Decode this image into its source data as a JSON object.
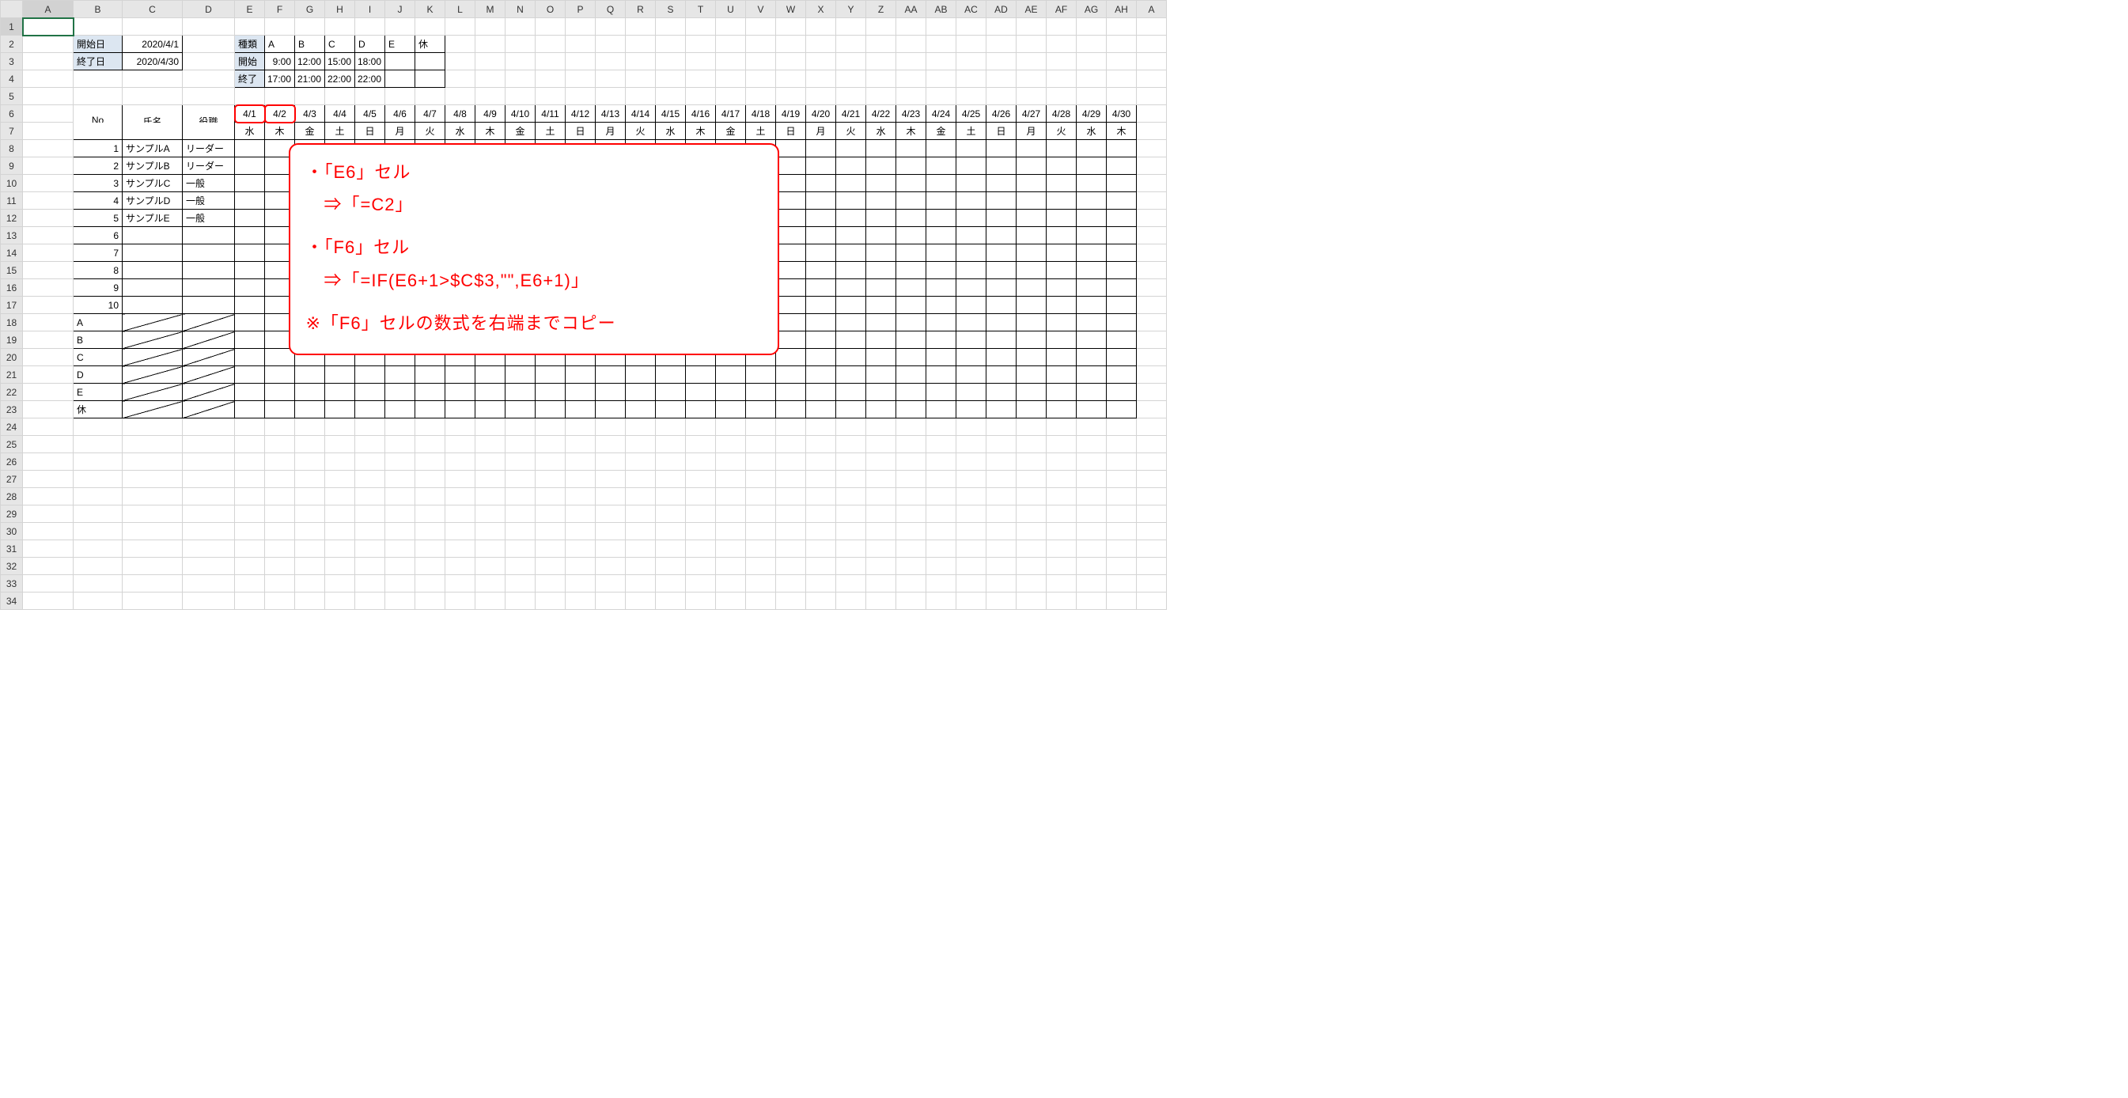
{
  "columns": [
    "",
    "A",
    "B",
    "C",
    "D",
    "E",
    "F",
    "G",
    "H",
    "I",
    "J",
    "K",
    "L",
    "M",
    "N",
    "O",
    "P",
    "Q",
    "R",
    "S",
    "T",
    "U",
    "V",
    "W",
    "X",
    "Y",
    "Z",
    "AA",
    "AB",
    "AC",
    "AD",
    "AE",
    "AF",
    "AG",
    "AH",
    "A"
  ],
  "rows": [
    "1",
    "2",
    "3",
    "4",
    "5",
    "6",
    "7",
    "8",
    "9",
    "10",
    "11",
    "12",
    "13",
    "14",
    "15",
    "16",
    "17",
    "18",
    "19",
    "20",
    "21",
    "22",
    "23",
    "24",
    "25",
    "26",
    "27",
    "28",
    "29",
    "30",
    "31",
    "32",
    "33",
    "34"
  ],
  "meta": {
    "start_label": "開始日",
    "start_date": "2020/4/1",
    "end_label": "終了日",
    "end_date": "2020/4/30",
    "kind_label": "種類",
    "kinds": [
      "A",
      "B",
      "C",
      "D",
      "E",
      "休"
    ],
    "begin_label": "開始",
    "begin_times": [
      "9:00",
      "12:00",
      "15:00",
      "18:00"
    ],
    "fin_label": "終了",
    "fin_times": [
      "17:00",
      "21:00",
      "22:00",
      "22:00"
    ]
  },
  "schedule_header": {
    "no": "No",
    "name": "氏名",
    "role": "役職",
    "dates": [
      "4/1",
      "4/2",
      "4/3",
      "4/4",
      "4/5",
      "4/6",
      "4/7",
      "4/8",
      "4/9",
      "4/10",
      "4/11",
      "4/12",
      "4/13",
      "4/14",
      "4/15",
      "4/16",
      "4/17",
      "4/18",
      "4/19",
      "4/20",
      "4/21",
      "4/22",
      "4/23",
      "4/24",
      "4/25",
      "4/26",
      "4/27",
      "4/28",
      "4/29",
      "4/30"
    ],
    "dows": [
      "水",
      "木",
      "金",
      "土",
      "日",
      "月",
      "火",
      "水",
      "木",
      "金",
      "土",
      "日",
      "月",
      "火",
      "水",
      "木",
      "金",
      "土",
      "日",
      "月",
      "火",
      "水",
      "木",
      "金",
      "土",
      "日",
      "月",
      "火",
      "水",
      "木"
    ]
  },
  "people": [
    {
      "no": "1",
      "name": "サンプルA",
      "role": "リーダー"
    },
    {
      "no": "2",
      "name": "サンプルB",
      "role": "リーダー"
    },
    {
      "no": "3",
      "name": "サンプルC",
      "role": "一般"
    },
    {
      "no": "4",
      "name": "サンプルD",
      "role": "一般"
    },
    {
      "no": "5",
      "name": "サンプルE",
      "role": "一般"
    },
    {
      "no": "6",
      "name": "",
      "role": ""
    },
    {
      "no": "7",
      "name": "",
      "role": ""
    },
    {
      "no": "8",
      "name": "",
      "role": ""
    },
    {
      "no": "9",
      "name": "",
      "role": ""
    },
    {
      "no": "10",
      "name": "",
      "role": ""
    }
  ],
  "summary_rows": [
    "A",
    "B",
    "C",
    "D",
    "E",
    "休"
  ],
  "callout": {
    "l1": "・「E6」セル",
    "l2": "　⇒「=C2」",
    "l3": "・「F6」セル",
    "l4": "　⇒「=IF(E6+1>$C$3,\"\",E6+1)」",
    "l5": "※「F6」セルの数式を右端までコピー"
  }
}
